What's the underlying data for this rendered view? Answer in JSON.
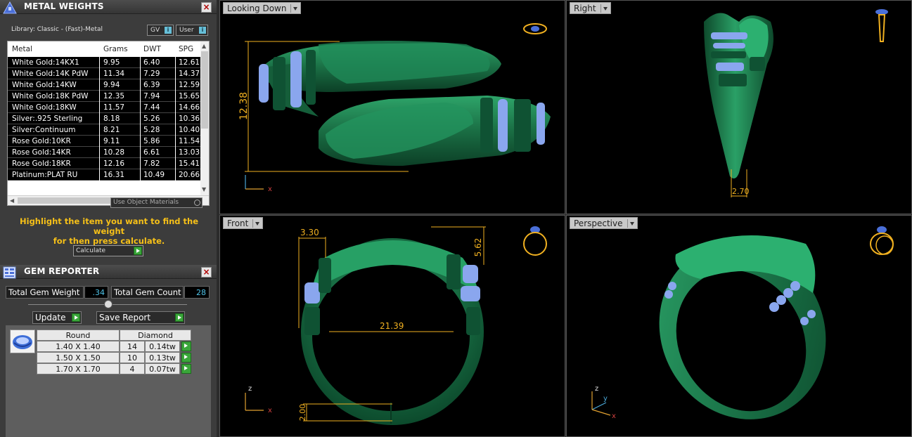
{
  "metal_weights": {
    "title": "METAL WEIGHTS",
    "library_label": "Library: Classic - (Fast)-Metal",
    "toggle_gv": "GV",
    "toggle_user": "User",
    "columns": [
      "Metal",
      "Grams",
      "DWT",
      "SPG"
    ],
    "rows": [
      [
        "White Gold:14KX1",
        "9.95",
        "6.40",
        "12.61"
      ],
      [
        "White Gold:14K PdW",
        "11.34",
        "7.29",
        "14.37"
      ],
      [
        "White Gold:14KW",
        "9.94",
        "6.39",
        "12.59"
      ],
      [
        "White Gold:18K PdW",
        "12.35",
        "7.94",
        "15.65"
      ],
      [
        "White Gold:18KW",
        "11.57",
        "7.44",
        "14.66"
      ],
      [
        "Silver:.925 Sterling",
        "8.18",
        "5.26",
        "10.36"
      ],
      [
        "Silver:Continuum",
        "8.21",
        "5.28",
        "10.40"
      ],
      [
        "Rose Gold:10KR",
        "9.11",
        "5.86",
        "11.54"
      ],
      [
        "Rose Gold:14KR",
        "10.28",
        "6.61",
        "13.03"
      ],
      [
        "Rose Gold:18KR",
        "12.16",
        "7.82",
        "15.41"
      ],
      [
        "Platinum:PLAT RU",
        "16.31",
        "10.49",
        "20.66"
      ]
    ],
    "use_object_materials": "Use Object Materials",
    "hint_line1": "Highlight the item you want to find the weight",
    "hint_line2": "for then press calculate.",
    "calculate": "Calculate"
  },
  "gem_reporter": {
    "title": "GEM REPORTER",
    "total_weight_label": "Total Gem Weight",
    "total_weight_value": ".34",
    "total_count_label": "Total Gem Count",
    "total_count_value": "28",
    "update": "Update",
    "save_report": "Save Report",
    "shape": "Round",
    "material": "Diamond",
    "rows": [
      {
        "size": "1.40 X 1.40",
        "count": "14",
        "tw": "0.14tw"
      },
      {
        "size": "1.50 X 1.50",
        "count": "10",
        "tw": "0.13tw"
      },
      {
        "size": "1.70 X 1.70",
        "count": "4",
        "tw": "0.07tw"
      }
    ]
  },
  "viewports": {
    "top": {
      "label": "Looking Down",
      "dim": "12.38"
    },
    "right": {
      "label": "Right",
      "dim": "2.70"
    },
    "front": {
      "label": "Front",
      "dim_a": "3.30",
      "dim_b": "5.62",
      "dim_c": "21.39",
      "dim_d": "2.00"
    },
    "perspective": {
      "label": "Perspective"
    }
  },
  "axes": {
    "x": "x",
    "y": "y",
    "z": "z"
  },
  "colors": {
    "ring_green": "#1f7a4c",
    "gem_blue": "#8aa6ee",
    "dimension": "#f0b020",
    "hint": "#f6c018",
    "accent_blue": "#4fc3e8"
  }
}
